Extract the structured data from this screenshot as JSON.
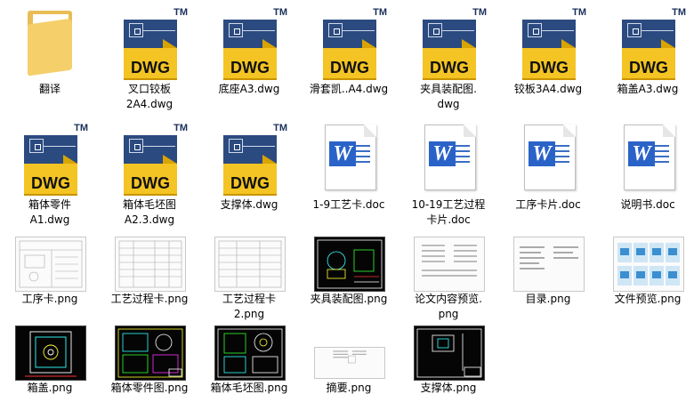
{
  "files": [
    {
      "label": "翻译",
      "kind": "folder"
    },
    {
      "label": "叉口铰板\n2A4.dwg",
      "kind": "dwg"
    },
    {
      "label": "底座A3.dwg",
      "kind": "dwg"
    },
    {
      "label": "滑套凯..A4.dwg",
      "kind": "dwg"
    },
    {
      "label": "夹具装配图.\ndwg",
      "kind": "dwg"
    },
    {
      "label": "铰板3A4.dwg",
      "kind": "dwg"
    },
    {
      "label": "箱盖A3.dwg",
      "kind": "dwg"
    },
    {
      "label": "箱体零件\nA1.dwg",
      "kind": "dwg"
    },
    {
      "label": "箱体毛坯图\nA2.3.dwg",
      "kind": "dwg"
    },
    {
      "label": "支撑体.dwg",
      "kind": "dwg"
    },
    {
      "label": "1-9工艺卡.doc",
      "kind": "doc"
    },
    {
      "label": "10-19工艺过程\n卡片.doc",
      "kind": "doc"
    },
    {
      "label": "工序卡片.doc",
      "kind": "doc"
    },
    {
      "label": "说明书.doc",
      "kind": "doc"
    },
    {
      "label": "工序卡.png",
      "kind": "png-light"
    },
    {
      "label": "工艺过程卡.png",
      "kind": "png-light"
    },
    {
      "label": "工艺过程卡\n2.png",
      "kind": "png-light"
    },
    {
      "label": "夹具装配图.png",
      "kind": "png-dark"
    },
    {
      "label": "论文内容预览.\npng",
      "kind": "png-light"
    },
    {
      "label": "目录.png",
      "kind": "png-light"
    },
    {
      "label": "文件预览.png",
      "kind": "png-light"
    },
    {
      "label": "箱盖.png",
      "kind": "png-dark"
    },
    {
      "label": "箱体零件图.png",
      "kind": "png-dark"
    },
    {
      "label": "箱体毛坯图.png",
      "kind": "png-dark"
    },
    {
      "label": "摘要.png",
      "kind": "png-light"
    },
    {
      "label": "支撑体.png",
      "kind": "png-dark"
    }
  ],
  "icons": {
    "dwg_text": "DWG",
    "dwg_tm": "TM",
    "doc_letter": "W"
  },
  "colors": {
    "dwg_blue": "#2b4a7f",
    "dwg_yellow": "#f3c423",
    "word_blue": "#2a63c8",
    "folder": "#f4cf6a"
  }
}
